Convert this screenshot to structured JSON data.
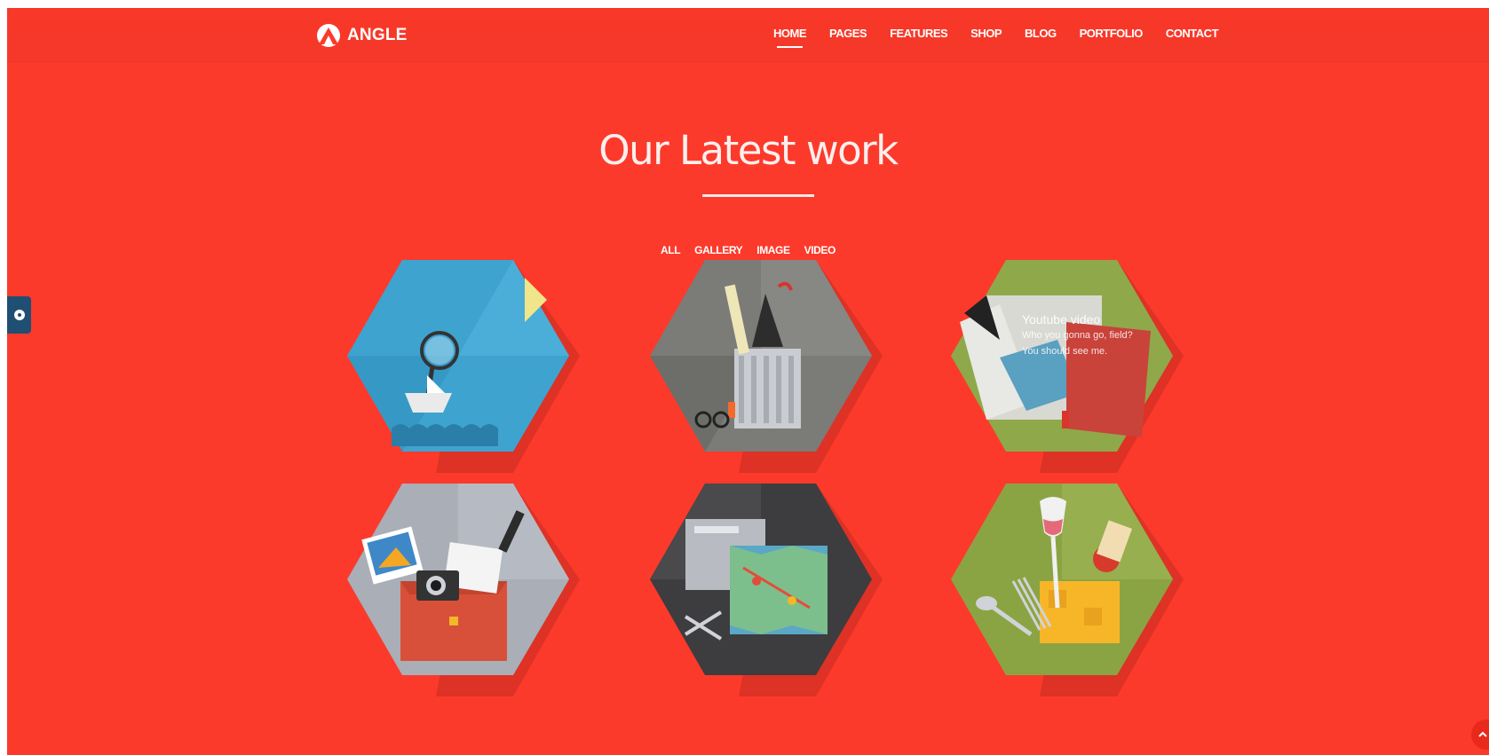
{
  "brand": {
    "name": "ANGLE"
  },
  "nav": {
    "items": [
      {
        "label": "HOME",
        "active": true
      },
      {
        "label": "PAGES",
        "active": false
      },
      {
        "label": "FEATURES",
        "active": false
      },
      {
        "label": "SHOP",
        "active": false
      },
      {
        "label": "BLOG",
        "active": false
      },
      {
        "label": "PORTFOLIO",
        "active": false
      },
      {
        "label": "CONTACT",
        "active": false
      }
    ]
  },
  "section": {
    "title": "Our Latest work",
    "filters": [
      "ALL",
      "GALLERY",
      "IMAGE",
      "VIDEO"
    ]
  },
  "portfolio": {
    "items": [
      {
        "icon": "magnifier-paper-boat-icon",
        "bg": "#3fa3cf"
      },
      {
        "icon": "office-supplies-bin-icon",
        "bg": "#7b7b78"
      },
      {
        "icon": "envelope-letter-icon",
        "bg": "#8fa84a",
        "overlay": {
          "title": "Youtube video",
          "line1": "Who you gonna go, field?",
          "line2": "You should see me."
        }
      },
      {
        "icon": "camera-photos-bag-icon",
        "bg": "#a9aeb7"
      },
      {
        "icon": "map-folder-scissors-icon",
        "bg": "#3d3c3f"
      },
      {
        "icon": "picnic-basket-wine-icon",
        "bg": "#8ba443"
      }
    ]
  },
  "colors": {
    "accent": "#fc3a2b",
    "side_tab": "#1f4f72"
  }
}
